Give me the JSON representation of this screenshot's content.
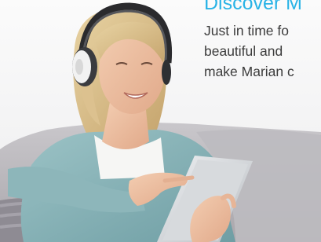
{
  "banner": {
    "headline": "Discover M",
    "body_lines": [
      "Just in time fo",
      "beautiful and",
      "make Marian c"
    ],
    "colors": {
      "headline": "#29b3e6",
      "body_text": "#3c3c3c",
      "background": "#f4f4f5"
    },
    "image": {
      "subject": "woman-with-headphones-using-tablet",
      "icon": "headphones-icon"
    }
  }
}
